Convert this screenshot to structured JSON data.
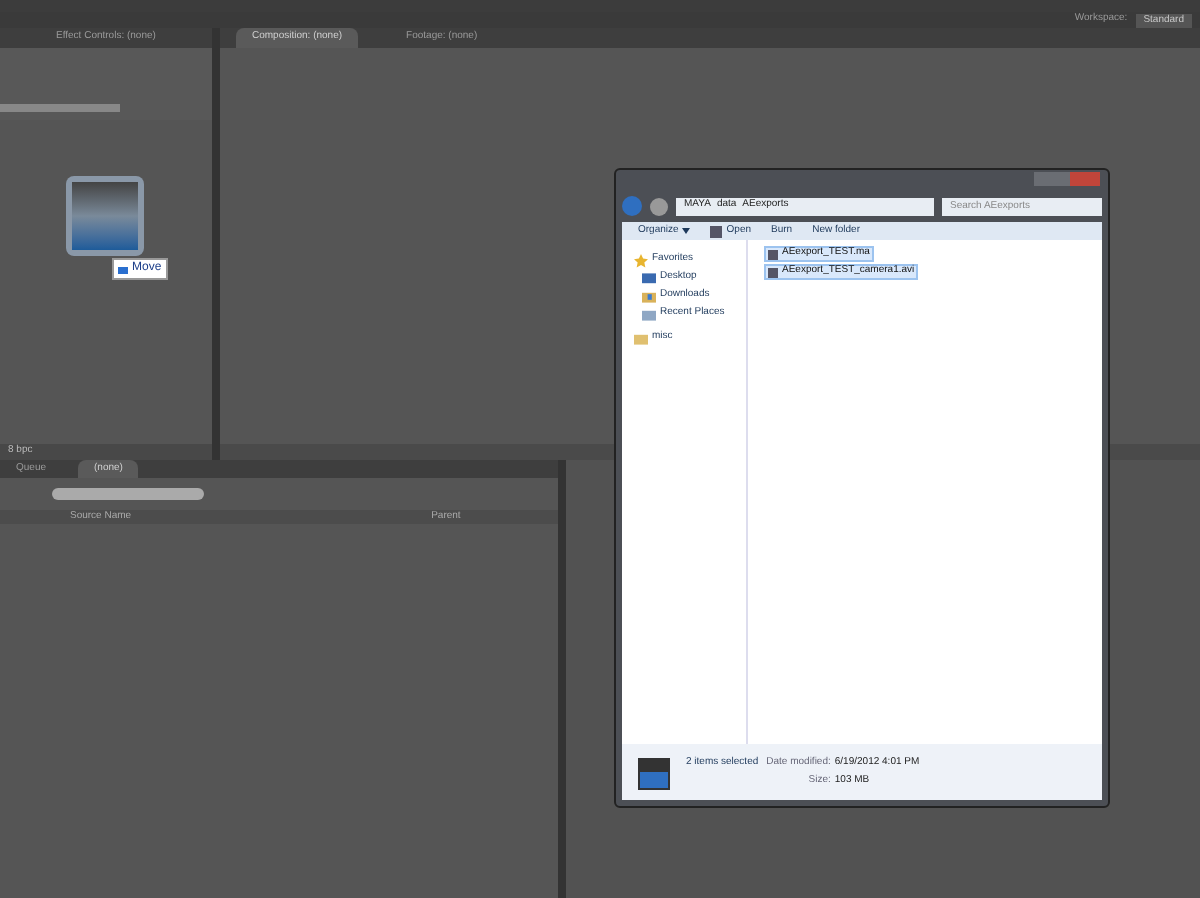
{
  "app": {
    "workspace_label": "Workspace:",
    "workspace": "Standard",
    "left_tabs": [
      {
        "label": "Effect Controls: (none)",
        "selected": false
      }
    ],
    "viewer_tabs": [
      {
        "label": "Composition: (none)",
        "selected": true
      },
      {
        "label": "Footage: (none)",
        "selected": false
      }
    ],
    "project": {
      "bit_depth": "8 bpc"
    },
    "drag": {
      "tooltip": "Move"
    },
    "timeline": {
      "tabs": [
        {
          "label": "Queue",
          "selected": false
        },
        {
          "label": "(none)",
          "selected": true
        }
      ],
      "columns": [
        "Source Name",
        "Parent"
      ]
    }
  },
  "explorer": {
    "path": [
      "MAYA",
      "data",
      "AEexports"
    ],
    "search": {
      "placeholder": "Search AEexports"
    },
    "toolbar": [
      {
        "label": "Organize",
        "kind": "menu"
      },
      {
        "label": "Open",
        "kind": "open"
      },
      {
        "label": "Burn",
        "kind": "plain"
      },
      {
        "label": "New folder",
        "kind": "plain"
      }
    ],
    "nav": [
      {
        "label": "Favorites",
        "kind": "star"
      },
      {
        "label": "Desktop",
        "kind": "desktop"
      },
      {
        "label": "Downloads",
        "kind": "downloads"
      },
      {
        "label": "Recent Places",
        "kind": "recent"
      },
      {
        "label": "misc",
        "kind": "folder"
      }
    ],
    "files": [
      {
        "name": "AEexport_TEST.ma",
        "selected": true
      },
      {
        "name": "AEexport_TEST_camera1.avi",
        "selected": true
      }
    ],
    "details": {
      "summary": "2 items selected",
      "date_label": "Date modified:",
      "date": "6/19/2012 4:01 PM",
      "size_label": "Size:",
      "size": "103 MB"
    }
  }
}
